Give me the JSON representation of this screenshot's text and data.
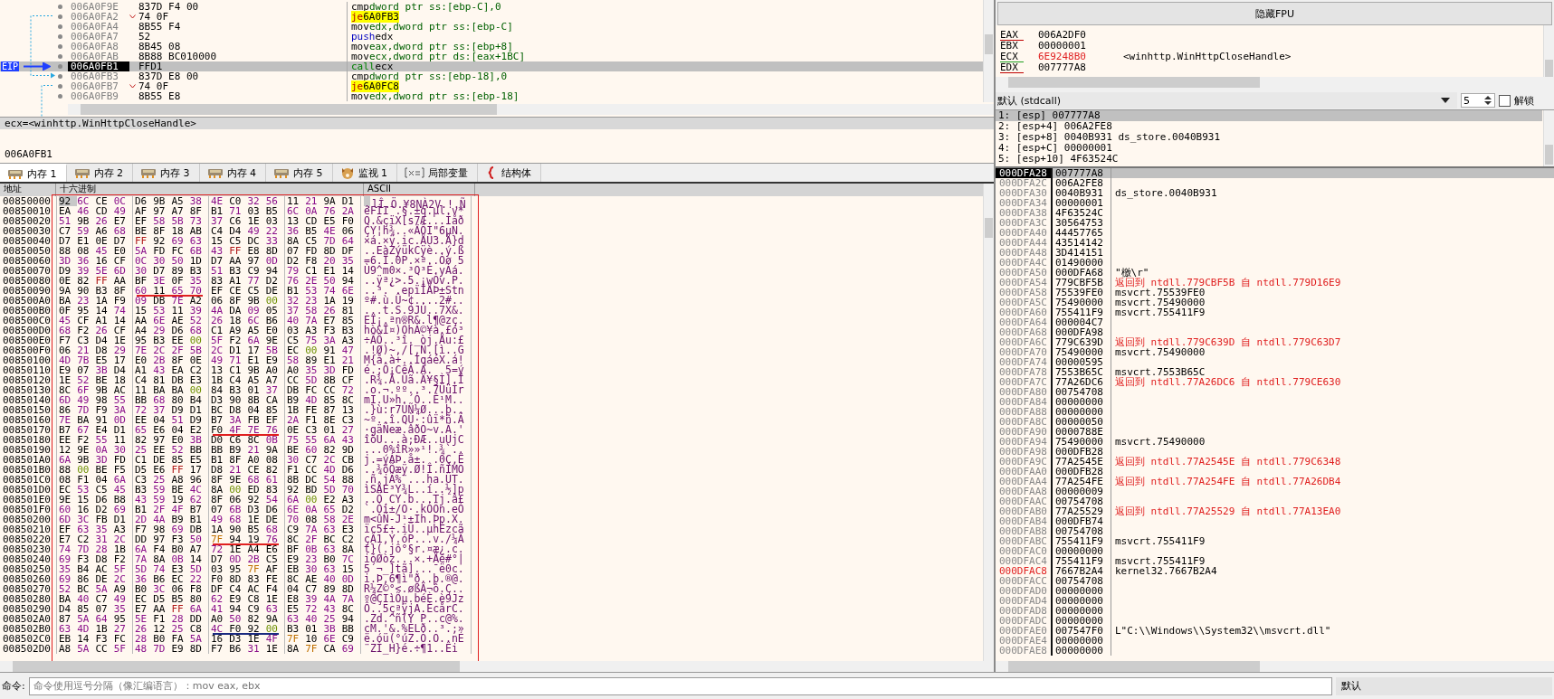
{
  "disassembly": {
    "eip_label": "EIP",
    "rows": [
      {
        "address": "006A0F9E",
        "bytes": "837D F4 00",
        "mnemonic": "cmp",
        "operands": "dword ptr ss:[ebp-C],0",
        "kind": "cmp",
        "current": false
      },
      {
        "address": "006A0FA2",
        "bytes": "74 0F",
        "mnemonic": "je",
        "operands": "6A0FB3",
        "kind": "jump",
        "current": false
      },
      {
        "address": "006A0FA4",
        "bytes": "8B55 F4",
        "mnemonic": "mov",
        "operands": "edx,dword ptr ss:[ebp-C]",
        "kind": "mov",
        "current": false
      },
      {
        "address": "006A0FA7",
        "bytes": "52",
        "mnemonic": "push",
        "operands": "edx",
        "kind": "push",
        "current": false
      },
      {
        "address": "006A0FA8",
        "bytes": "8B45 08",
        "mnemonic": "mov",
        "operands": "eax,dword ptr ss:[ebp+8]",
        "kind": "mov",
        "current": false
      },
      {
        "address": "006A0FAB",
        "bytes": "8B88 BC010000",
        "mnemonic": "mov",
        "operands": "ecx,dword ptr ds:[eax+1BC]",
        "kind": "mov",
        "current": false
      },
      {
        "address": "006A0FB1",
        "bytes": "FFD1",
        "mnemonic": "call",
        "operands": "ecx",
        "kind": "call",
        "current": true
      },
      {
        "address": "006A0FB3",
        "bytes": "837D E8 00",
        "mnemonic": "cmp",
        "operands": "dword ptr ss:[ebp-18],0",
        "kind": "cmp",
        "current": false
      },
      {
        "address": "006A0FB7",
        "bytes": "74 0F",
        "mnemonic": "je",
        "operands": "6A0FC8",
        "kind": "jump",
        "current": false
      },
      {
        "address": "006A0FB9",
        "bytes": "8B55 E8",
        "mnemonic": "mov",
        "operands": "edx,dword ptr ss:[ebp-18]",
        "kind": "mov",
        "current": false
      }
    ]
  },
  "info": {
    "header": "ecx=<winhttp.WinHttpCloseHandle>",
    "address": "006A0FB1"
  },
  "tabs": [
    {
      "label": "内存 1",
      "kind": "memory",
      "selected": true
    },
    {
      "label": "内存 2",
      "kind": "memory",
      "selected": false
    },
    {
      "label": "内存 3",
      "kind": "memory",
      "selected": false
    },
    {
      "label": "内存 4",
      "kind": "memory",
      "selected": false
    },
    {
      "label": "内存 5",
      "kind": "memory",
      "selected": false
    },
    {
      "label": "监视 1",
      "kind": "watch",
      "selected": false
    },
    {
      "label": "局部变量",
      "kind": "locals",
      "selected": false
    },
    {
      "label": "结构体",
      "kind": "struct",
      "selected": false
    }
  ],
  "memory": {
    "columns": [
      "地址",
      "十六进制",
      "ASCII"
    ],
    "annotation": {
      "color": "#e02020"
    },
    "rows": [
      {
        "address": "00850000",
        "hex": [
          "92 6C CE 0C",
          "D6 9B A5 38",
          "4E C0 32 56",
          "11 21 9A D1"
        ],
        "ascii": ".lÎ.Ö.¥8NÀ2V.!.Ñ",
        "selected": true
      },
      {
        "address": "00850010",
        "hex": [
          "EA 46 CD 49",
          "AF 97 A7 8F",
          "B1 71 03 B5",
          "6C 0A 76 2A"
        ],
        "ascii": "êFÍI¯.§.±q.µl.v*",
        "selected": false
      },
      {
        "address": "00850020",
        "hex": [
          "51 9B 26 E7",
          "EF 58 5B 73",
          "37 C6 1E 03",
          "13 CD E5 F0"
        ],
        "ascii": "Q.&çïX[s7Æ...Íåð",
        "selected": false
      },
      {
        "address": "00850030",
        "hex": [
          "C7 59 A6 68",
          "BE 8F 18 AB",
          "C4 D4 49 22",
          "36 B5 4E 06"
        ],
        "ascii": "ÇY¦h¾..«ÄÔI\"6µN.",
        "selected": false
      },
      {
        "address": "00850040",
        "hex": [
          "D7 E1 0E D7",
          "FF 92 69 63",
          "15 C5 DC 33",
          "8A C5 7D 64"
        ],
        "ascii": "×á.×ÿ.ic.ÅÜ3.Å}d",
        "selected": false
      },
      {
        "address": "00850050",
        "hex": [
          "88 08 45 E0",
          "5A FD FC 6B",
          "43 FF E8 8D",
          "07 FD 8D DF"
        ],
        "ascii": "..EàZýükCÿè..ý.ß",
        "selected": false
      },
      {
        "address": "00850060",
        "hex": [
          "3D 36 16 CF",
          "0C 30 50 1D",
          "D7 AA 97 0D",
          "D2 F8 20 35"
        ],
        "ascii": "=6.Ï.0P.×ª..Òø 5",
        "selected": false
      },
      {
        "address": "00850070",
        "hex": [
          "D9 39 5E 6D",
          "30 D7 89 B3",
          "51 B3 C9 94",
          "79 C1 E1 14"
        ],
        "ascii": "Ù9^m0×.³Q³É.yÁá.",
        "selected": false
      },
      {
        "address": "00850080",
        "hex": [
          "0E 82 FF AA",
          "BF 3E 0F 35",
          "83 A1 77 D2",
          "76 2E 50 94"
        ],
        "ascii": "..ÿª¿>.5.¡wÒv.P.",
        "selected": false
      },
      {
        "address": "00850090",
        "hex": [
          "9A 90 B3 8F",
          "60 11 65 70",
          "EF CE C5 DE",
          "B1 53 74 6E"
        ],
        "ascii": "..³.`.epïÎÅÞ±Stn",
        "selected": false,
        "underline": {
          "groups": [
            false,
            true,
            false,
            false
          ],
          "color": "#e02020"
        }
      },
      {
        "address": "008500A0",
        "hex": [
          "BA 23 1A F9",
          "09 DB 7E A2",
          "06 8F 9B 00",
          "32 23 1A 19"
        ],
        "ascii": "º#.ù.Û~¢....2#..",
        "selected": false
      },
      {
        "address": "008500B0",
        "hex": [
          "0F 95 14 74",
          "15 53 11 39",
          "4A DA 09 05",
          "37 58 26 81"
        ],
        "ascii": "...t.S.9JÚ..7X&.",
        "selected": false
      },
      {
        "address": "008500C0",
        "hex": [
          "45 CF A1 14",
          "AA 6E AE 52",
          "26 18 6C B6",
          "40 7A E7 85"
        ],
        "ascii": "EÏ¡.ªn®R&.l¶@zç.",
        "selected": false
      },
      {
        "address": "008500D0",
        "hex": [
          "68 F2 26 CF",
          "A4 29 D6 68",
          "C1 A9 A5 E0",
          "03 A3 F3 B3"
        ],
        "ascii": "hò&Ï¤)ÖhÁ©¥à.£ó³",
        "selected": false
      },
      {
        "address": "008500E0",
        "hex": [
          "F7 C3 D4 1E",
          "95 B3 EE 00",
          "5F F2 6A 9E",
          "C5 75 3A A3"
        ],
        "ascii": "÷ÃÔ..³î._òj.Åu:£",
        "selected": false
      },
      {
        "address": "008500F0",
        "hex": [
          "06 21 D8 29",
          "7E 2C 2F 5B",
          "2C D1 17 5B",
          "EC 00 91 47"
        ],
        "ascii": ".!Ø)~,/[,Ñ.[ì..G",
        "selected": false
      },
      {
        "address": "00850100",
        "hex": [
          "4D 7B E5 17",
          "E0 2B 8F 0E",
          "49 71 E1 E9",
          "58 89 E1 21"
        ],
        "ascii": "M{å.à+..IqáéX.á!",
        "selected": false
      },
      {
        "address": "00850110",
        "hex": [
          "E9 07 3B D4",
          "A1 43 EA C2",
          "13 C1 9B A0",
          "A0 35 3D FD"
        ],
        "ascii": "é.;Ô¡CêÂ.Á.  5=ý",
        "selected": false
      },
      {
        "address": "00850120",
        "hex": [
          "1E 52 BE 18",
          "C4 81 DB E3",
          "1B C4 A5 A7",
          "CC 5D 8B CF"
        ],
        "ascii": ".R¾.Ä.Ûã.Ä¥§Ì].Ï",
        "selected": false
      },
      {
        "address": "00850130",
        "hex": [
          "8C 6F 9B AC",
          "11 BA BA 00",
          "84 B3 01 37",
          "DB FC CC 72"
        ],
        "ascii": ".o.¬.ºº..³.7ÛüÌr",
        "selected": false
      },
      {
        "address": "00850140",
        "hex": [
          "6D 49 98 55",
          "BB 68 80 B4",
          "D3 90 8B CA",
          "B9 4D 85 8C"
        ],
        "ascii": "mI.U»h.´Ó..Ê¹M..",
        "selected": false
      },
      {
        "address": "00850150",
        "hex": [
          "86 7D F9 3A",
          "72 37 D9 D1",
          "BC D8 04 85",
          "1B FE 87 13"
        ],
        "ascii": ".}ù:r7ÙÑ¼Ø...þ..",
        "selected": false
      },
      {
        "address": "00850160",
        "hex": [
          "7E BA 91 0D",
          "EE 04 51 D9",
          "B7 3A FB EF",
          "2A F1 8E C3"
        ],
        "ascii": "~º..î.QÙ·:ûï*ñ.Ã",
        "selected": false
      },
      {
        "address": "00850170",
        "hex": [
          "B7 67 E4 D1",
          "65 E6 04 E2",
          "F0 4F 7E 76",
          "0E C3 01 27"
        ],
        "ascii": "·gäÑeæ.âðO~v.Ã.'",
        "selected": false,
        "underline": {
          "groups": [
            false,
            false,
            true,
            false
          ],
          "color": "#e02020"
        }
      },
      {
        "address": "00850180",
        "hex": [
          "EE F2 55 11",
          "82 97 E0 3B",
          "D0 C6 8C 0B",
          "75 55 6A 43"
        ],
        "ascii": "îòU...à;ÐÆ..uUjC",
        "selected": false
      },
      {
        "address": "00850190",
        "hex": [
          "12 9E 0A 30",
          "25 EE 52 BB",
          "BB B9 21 9A",
          "BE 60 82 9D"
        ],
        "ascii": "...0%îR»»¹!.¾`..",
        "selected": false
      },
      {
        "address": "008501A0",
        "hex": [
          "6A 9B 3D FD",
          "C1 DE 85 E5",
          "B1 8F A0 08",
          "30 C7 2C CB"
        ],
        "ascii": "j.=ýÁÞ.å±. .0Ç,Ë",
        "selected": false
      },
      {
        "address": "008501B0",
        "hex": [
          "88 00 BE F5",
          "D5 E6 FF 17",
          "D8 21 CE 82",
          "F1 CC 4D D6"
        ],
        "ascii": "..¾õÕæÿ.Ø!Î.ñÌMÖ",
        "selected": false
      },
      {
        "address": "008501C0",
        "hex": [
          "08 F1 04 6A",
          "C3 25 A8 96",
          "8F 9E 68 61",
          "8B DC 54 88"
        ],
        "ascii": ".ñ.jÃ%¨...ha.ÜT.",
        "selected": false
      },
      {
        "address": "008501D0",
        "hex": [
          "EC 53 C5 45",
          "B3 59 BE 4C",
          "8A 00 ED 83",
          "92 BD 5D 70"
        ],
        "ascii": "ìSÅE³Y¾L..í..½]p",
        "selected": false
      },
      {
        "address": "008501E0",
        "hex": [
          "9E 15 D6 B8",
          "43 59 19 62",
          "8F 06 92 54",
          "6A 00 E2 A3"
        ],
        "ascii": "..Ö¸CY.b...Tj.â£",
        "selected": false
      },
      {
        "address": "008501F0",
        "hex": [
          "60 16 D2 69",
          "B1 2F 4F B7",
          "07 6B D3 D6",
          "6E 0A 65 D2"
        ],
        "ascii": "`.Òi±/O·.kÓÖn.eÒ",
        "selected": false
      },
      {
        "address": "00850200",
        "hex": [
          "6D 3C FB D1",
          "2D 4A B9 B1",
          "49 68 1E DE",
          "70 08 58 2E"
        ],
        "ascii": "m<ûÑ-J¹±Ih.Þp.X.",
        "selected": false
      },
      {
        "address": "00850210",
        "hex": [
          "EF 63 35 A3",
          "F7 98 69 DB",
          "1A 90 B5 68",
          "C9 7A 63 E3"
        ],
        "ascii": "ïc5£÷.iÛ..µhÉzcã",
        "selected": false
      },
      {
        "address": "00850220",
        "hex": [
          "E7 C2 31 2C",
          "DD 97 F3 50",
          "7F 94 19 76",
          "8C 2F BC C2"
        ],
        "ascii": "çÂ1,Ý.óP...v./¼Â",
        "selected": false,
        "underline": {
          "groups": [
            false,
            false,
            true,
            false
          ],
          "color": "#e02020"
        }
      },
      {
        "address": "00850230",
        "hex": [
          "74 7D 28 1B",
          "6A F4 B0 A7",
          "72 1E A4 E6",
          "BF 0B 63 8A"
        ],
        "ascii": "t}(.jô°§r.¤æ¿.c.",
        "selected": false
      },
      {
        "address": "00850240",
        "hex": [
          "69 F3 D8 F2",
          "7A 8A 0B 14",
          "D7 0D 2B C5",
          "E9 23 B0 7C"
        ],
        "ascii": "ióØòz...×.+Åé#°|",
        "selected": false
      },
      {
        "address": "00850250",
        "hex": [
          "35 B4 AC 5F",
          "5D 74 E3 5D",
          "03 95 7F AF",
          "EB 30 63 15"
        ],
        "ascii": "5´¬_]tã]...¯ë0c.",
        "selected": false
      },
      {
        "address": "00850260",
        "hex": [
          "69 86 DE 2C",
          "36 B6 EC 22",
          "F0 8D 83 FE",
          "8C AE 40 0D"
        ],
        "ascii": "i.Þ,6¶ì\"ð..þ.®@.",
        "selected": false
      },
      {
        "address": "00850270",
        "hex": [
          "52 BC 5A A9",
          "B0 3C 06 F8",
          "DF C4 AC F4",
          "04 C7 89 8D"
        ],
        "ascii": "R¼Z©°<.øßÄ¬ô.Ç..",
        "selected": false
      },
      {
        "address": "00850280",
        "hex": [
          "BA 40 C7 49",
          "EC D5 B5 80",
          "62 E9 C8 1E",
          "E8 39 4A 7A"
        ],
        "ascii": "º@ÇIìÕµ.béÈ.è9Jz",
        "selected": false
      },
      {
        "address": "00850290",
        "hex": [
          "D4 85 07 35",
          "E7 AA FF 6A",
          "41 94 C9 63",
          "E5 72 43 8C"
        ],
        "ascii": "Ô..5çªÿjA.ÉcårC.",
        "selected": false
      },
      {
        "address": "008502A0",
        "hex": [
          "87 5A 64 95",
          "5E F1 28 DD",
          "A0 50 82 9A",
          "63 40 25 94"
        ],
        "ascii": ".Zd.^ñ(Ý P..c@%.",
        "selected": false
      },
      {
        "address": "008502B0",
        "hex": [
          "63 4D 1B 27",
          "26 12 25 C8",
          "4C F0 92 00",
          "B3 01 3B BB"
        ],
        "ascii": "cM.'&.%ÈLð..³.;»",
        "selected": false,
        "underline": {
          "groups": [
            false,
            false,
            true,
            false
          ],
          "color": "#1a2a80"
        }
      },
      {
        "address": "008502C0",
        "hex": [
          "EB 14 F3 FC",
          "28 B0 FA 5A",
          "16 D3 1E 4F",
          "7F 10 6E C9"
        ],
        "ascii": "ë.óü(°úZ.Ó.O..nÉ",
        "selected": false
      },
      {
        "address": "008502D0",
        "hex": [
          "A8 5A CC 5F",
          "48 7D E9 8D",
          "F7 B6 31 1E",
          "8A 7F CA 69"
        ],
        "ascii": "¨ZÌ_H}é.÷¶1..Êi",
        "selected": false
      }
    ]
  },
  "fpu_button": "隐藏FPU",
  "registers": [
    {
      "name": "EAX",
      "value": "006A2DF0",
      "changed": false,
      "color": "#c00000"
    },
    {
      "name": "EBX",
      "value": "00000001",
      "changed": false
    },
    {
      "name": "ECX",
      "value": "6E9248B0",
      "changed": true,
      "color": "#20a020",
      "comment": "<winhttp.WinHttpCloseHandle>"
    },
    {
      "name": "EDX",
      "value": "007777A8",
      "changed": false,
      "color": "#c00000"
    }
  ],
  "call_convention": {
    "value": "默认 (stdcall)",
    "count": "5",
    "unlock": {
      "label": "解锁",
      "checked": false
    }
  },
  "arguments": [
    {
      "text": "1: [esp] 007777A8",
      "selected": true
    },
    {
      "text": "2: [esp+4] 006A2FE8",
      "selected": false
    },
    {
      "text": "3: [esp+8] 0040B931 ds_store.0040B931",
      "selected": false
    },
    {
      "text": "4: [esp+C] 00000001",
      "selected": false
    },
    {
      "text": "5: [esp+10] 4F63524C",
      "selected": false
    }
  ],
  "stack": [
    {
      "address": "000DFA28",
      "value": "007777A8",
      "selected": true,
      "highlight": false
    },
    {
      "address": "000DFA2C",
      "value": "006A2FE8",
      "selected": false,
      "highlight": false
    },
    {
      "address": "000DFA30",
      "value": "0040B931",
      "comment": "ds_store.0040B931",
      "kind": "plain",
      "selected": false,
      "highlight": false
    },
    {
      "address": "000DFA34",
      "value": "00000001",
      "selected": false,
      "highlight": false
    },
    {
      "address": "000DFA38",
      "value": "4F63524C",
      "selected": false,
      "highlight": false
    },
    {
      "address": "000DFA3C",
      "value": "30564753",
      "selected": false,
      "highlight": false
    },
    {
      "address": "000DFA40",
      "value": "44457765",
      "selected": false,
      "highlight": false
    },
    {
      "address": "000DFA44",
      "value": "43514142",
      "selected": false,
      "highlight": false
    },
    {
      "address": "000DFA48",
      "value": "3D414151",
      "selected": false,
      "highlight": false
    },
    {
      "address": "000DFA4C",
      "value": "01490000",
      "selected": false,
      "highlight": false
    },
    {
      "address": "000DFA50",
      "value": "000DFA68",
      "comment": "\"檄\\r\"",
      "kind": "plain",
      "selected": false,
      "highlight": false
    },
    {
      "address": "000DFA54",
      "value": "779CBF5B",
      "comment": "返回到 ntdll.779CBF5B 自 ntdll.779D16E9",
      "kind": "return",
      "selected": false,
      "highlight": false
    },
    {
      "address": "000DFA58",
      "value": "75539FE0",
      "comment": "msvcrt.75539FE0",
      "kind": "plain",
      "selected": false,
      "highlight": false
    },
    {
      "address": "000DFA5C",
      "value": "75490000",
      "comment": "msvcrt.75490000",
      "kind": "plain",
      "selected": false,
      "highlight": false
    },
    {
      "address": "000DFA60",
      "value": "755411F9",
      "comment": "msvcrt.755411F9",
      "kind": "plain",
      "selected": false,
      "highlight": false
    },
    {
      "address": "000DFA64",
      "value": "000004C7",
      "selected": false,
      "highlight": false
    },
    {
      "address": "000DFA68",
      "value": "000DFA98",
      "selected": false,
      "highlight": false
    },
    {
      "address": "000DFA6C",
      "value": "779C639D",
      "comment": "返回到 ntdll.779C639D 自 ntdll.779C63D7",
      "kind": "return",
      "selected": false,
      "highlight": false
    },
    {
      "address": "000DFA70",
      "value": "75490000",
      "comment": "msvcrt.75490000",
      "kind": "plain",
      "selected": false,
      "highlight": false
    },
    {
      "address": "000DFA74",
      "value": "00000595",
      "selected": false,
      "highlight": false
    },
    {
      "address": "000DFA78",
      "value": "7553B65C",
      "comment": "msvcrt.7553B65C",
      "kind": "plain",
      "selected": false,
      "highlight": false
    },
    {
      "address": "000DFA7C",
      "value": "77A26DC6",
      "comment": "返回到 ntdll.77A26DC6 自 ntdll.779CE630",
      "kind": "return",
      "selected": false,
      "highlight": false
    },
    {
      "address": "000DFA80",
      "value": "00754708",
      "selected": false,
      "highlight": false
    },
    {
      "address": "000DFA84",
      "value": "00000000",
      "selected": false,
      "highlight": false
    },
    {
      "address": "000DFA88",
      "value": "00000000",
      "selected": false,
      "highlight": false
    },
    {
      "address": "000DFA8C",
      "value": "00000050",
      "selected": false,
      "highlight": false
    },
    {
      "address": "000DFA90",
      "value": "0000788E",
      "selected": false,
      "highlight": false
    },
    {
      "address": "000DFA94",
      "value": "75490000",
      "comment": "msvcrt.75490000",
      "kind": "plain",
      "selected": false,
      "highlight": false
    },
    {
      "address": "000DFA98",
      "value": "000DFB28",
      "selected": false,
      "highlight": false
    },
    {
      "address": "000DFA9C",
      "value": "77A2545E",
      "comment": "返回到 ntdll.77A2545E 自 ntdll.779C6348",
      "kind": "return",
      "selected": false,
      "highlight": false
    },
    {
      "address": "000DFAA0",
      "value": "000DFB28",
      "selected": false,
      "highlight": false
    },
    {
      "address": "000DFAA4",
      "value": "77A254FE",
      "comment": "返回到 ntdll.77A254FE 自 ntdll.77A26DB4",
      "kind": "return",
      "selected": false,
      "highlight": false
    },
    {
      "address": "000DFAA8",
      "value": "00000009",
      "selected": false,
      "highlight": false
    },
    {
      "address": "000DFAAC",
      "value": "00754708",
      "selected": false,
      "highlight": false
    },
    {
      "address": "000DFAB0",
      "value": "77A25529",
      "comment": "返回到 ntdll.77A25529 自 ntdll.77A13EA0",
      "kind": "return",
      "selected": false,
      "highlight": false
    },
    {
      "address": "000DFAB4",
      "value": "000DFB74",
      "selected": false,
      "highlight": false
    },
    {
      "address": "000DFAB8",
      "value": "00754708",
      "selected": false,
      "highlight": false
    },
    {
      "address": "000DFABC",
      "value": "755411F9",
      "comment": "msvcrt.755411F9",
      "kind": "plain",
      "selected": false,
      "highlight": false
    },
    {
      "address": "000DFAC0",
      "value": "00000000",
      "selected": false,
      "highlight": false
    },
    {
      "address": "000DFAC4",
      "value": "755411F9",
      "comment": "msvcrt.755411F9",
      "kind": "plain",
      "selected": false,
      "highlight": false
    },
    {
      "address": "000DFAC8",
      "value": "7667B2A4",
      "comment": "kernel32.7667B2A4",
      "kind": "plain",
      "selected": false,
      "highlight": true
    },
    {
      "address": "000DFACC",
      "value": "00754708",
      "selected": false,
      "highlight": false
    },
    {
      "address": "000DFAD0",
      "value": "00000000",
      "selected": false,
      "highlight": false
    },
    {
      "address": "000DFAD4",
      "value": "00000000",
      "selected": false,
      "highlight": false
    },
    {
      "address": "000DFAD8",
      "value": "00000000",
      "selected": false,
      "highlight": false
    },
    {
      "address": "000DFADC",
      "value": "00000000",
      "selected": false,
      "highlight": false
    },
    {
      "address": "000DFAE0",
      "value": "007547F0",
      "comment": "L\"C:\\\\Windows\\\\System32\\\\msvcrt.dll\"",
      "kind": "plain",
      "selected": false,
      "highlight": false
    },
    {
      "address": "000DFAE4",
      "value": "00000000",
      "selected": false,
      "highlight": false
    },
    {
      "address": "000DFAE8",
      "value": "00000000",
      "selected": false,
      "highlight": false
    }
  ],
  "command": {
    "label": "命令:",
    "placeholder": "命令使用逗号分隔（像汇编语言）：mov eax, ebx",
    "mode": "默认"
  }
}
